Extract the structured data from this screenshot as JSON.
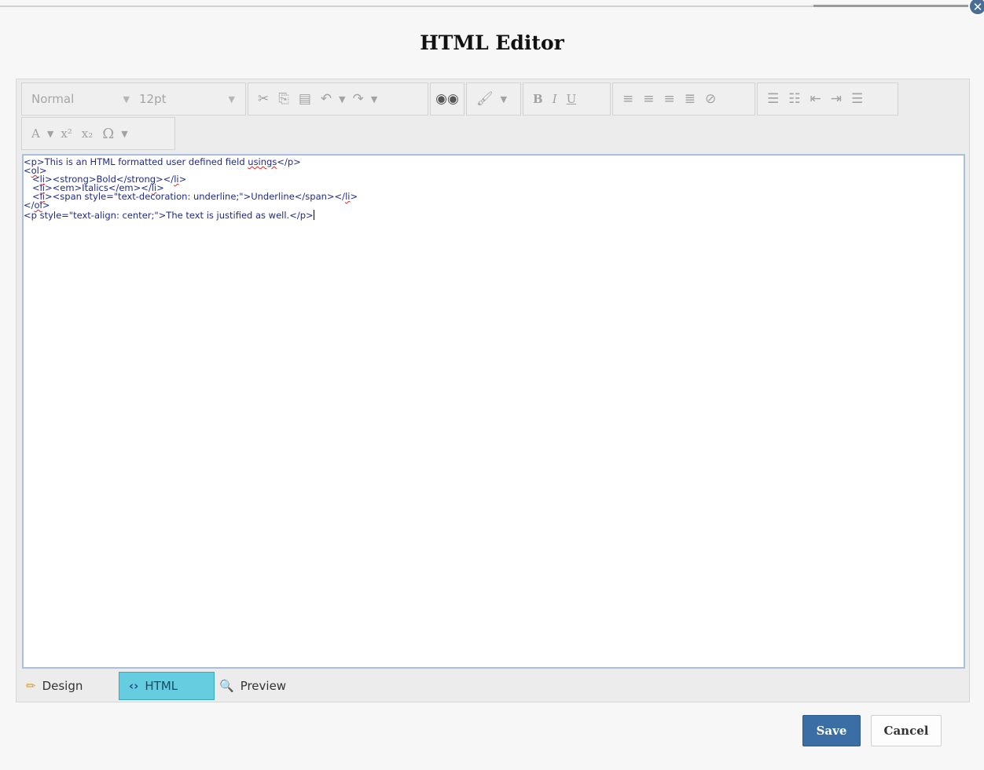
{
  "dialog": {
    "title": "HTML Editor",
    "close_icon": "close-circle-icon"
  },
  "toolbar": {
    "paragraph_format": "Normal",
    "font_size": "12pt",
    "dropdown_arrow": "▼",
    "icons": {
      "cut": "scissors-icon",
      "copy": "copy-icon",
      "paste": "paste-icon",
      "undo": "undo-icon",
      "redo": "redo-icon",
      "find": "binoculars-icon",
      "format_painter": "brush-icon",
      "bold": "B",
      "italic": "I",
      "underline": "U",
      "align_left": "align-left-icon",
      "align_center": "align-center-icon",
      "align_right": "align-right-icon",
      "justify": "justify-icon",
      "clear_format": "clear-format-icon",
      "ordered_list": "ordered-list-icon",
      "unordered_list": "unordered-list-icon",
      "outdent": "outdent-icon",
      "indent": "indent-icon",
      "horizontal_rule": "horizontal-rule-icon",
      "font_color": "A",
      "superscript": "x²",
      "subscript": "x₂",
      "symbol": "Ω"
    }
  },
  "code": {
    "line1_a": "<p>This is an HTML formatted user defined field ",
    "line1_word": "usings",
    "line1_b": "</p>",
    "line2_a": "<",
    "line2_word": "ol",
    "line2_b": ">",
    "line3_a": "   <",
    "line3_w1": "li",
    "line3_b": "><strong>Bold</strong></",
    "line3_w2": "li",
    "line3_c": ">",
    "line4_a": "   <",
    "line4_w1": "li",
    "line4_b": "><em>Italics</em></",
    "line4_w2": "li",
    "line4_c": ">",
    "line5_a": "   <",
    "line5_w1": "li",
    "line5_b": "><span style=\"text-decoration: underline;\">Underline</span></",
    "line5_w2": "li",
    "line5_c": ">",
    "line6_a": "</",
    "line6_word": "ol",
    "line6_b": ">",
    "line7": "<p style=\"text-align: center;\">The text is justified as well.</p>"
  },
  "modes": {
    "design": "Design",
    "html": "HTML",
    "preview": "Preview",
    "active": "HTML",
    "design_icon": "pencil-icon",
    "html_icon": "code-icon",
    "preview_icon": "magnifier-icon"
  },
  "buttons": {
    "save": "Save",
    "cancel": "Cancel",
    "save_color": "#3b6ea5"
  }
}
